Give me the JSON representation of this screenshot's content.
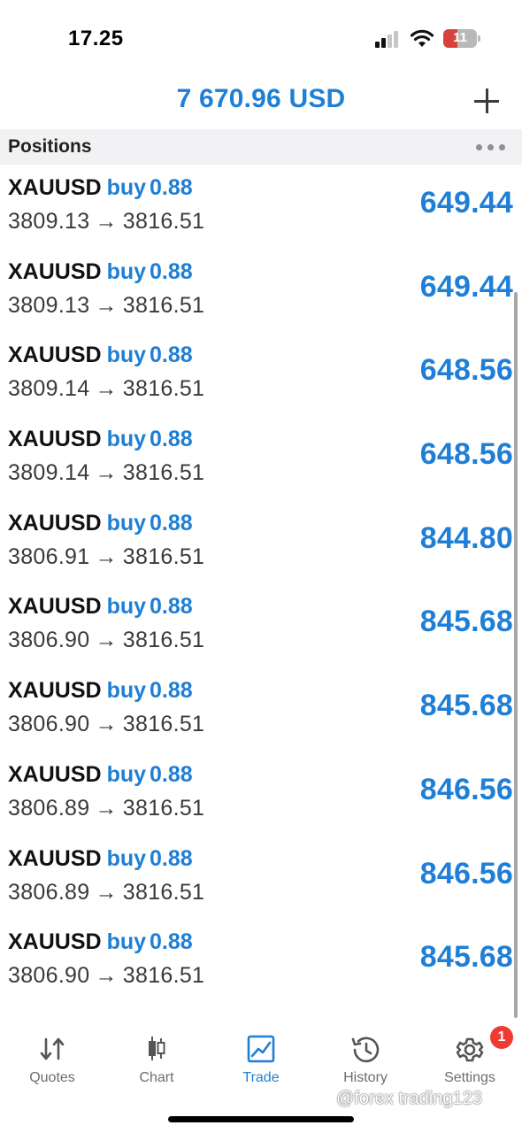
{
  "status_bar": {
    "time": "17.25",
    "battery": "11"
  },
  "header": {
    "balance": "7 670.96 USD"
  },
  "section": {
    "title": "Positions"
  },
  "positions": [
    {
      "symbol": "XAUUSD",
      "direction": "buy",
      "volume": "0.88",
      "open_price": "3809.13",
      "current_price": "3816.51",
      "profit": "649.44"
    },
    {
      "symbol": "XAUUSD",
      "direction": "buy",
      "volume": "0.88",
      "open_price": "3809.13",
      "current_price": "3816.51",
      "profit": "649.44"
    },
    {
      "symbol": "XAUUSD",
      "direction": "buy",
      "volume": "0.88",
      "open_price": "3809.14",
      "current_price": "3816.51",
      "profit": "648.56"
    },
    {
      "symbol": "XAUUSD",
      "direction": "buy",
      "volume": "0.88",
      "open_price": "3809.14",
      "current_price": "3816.51",
      "profit": "648.56"
    },
    {
      "symbol": "XAUUSD",
      "direction": "buy",
      "volume": "0.88",
      "open_price": "3806.91",
      "current_price": "3816.51",
      "profit": "844.80"
    },
    {
      "symbol": "XAUUSD",
      "direction": "buy",
      "volume": "0.88",
      "open_price": "3806.90",
      "current_price": "3816.51",
      "profit": "845.68"
    },
    {
      "symbol": "XAUUSD",
      "direction": "buy",
      "volume": "0.88",
      "open_price": "3806.90",
      "current_price": "3816.51",
      "profit": "845.68"
    },
    {
      "symbol": "XAUUSD",
      "direction": "buy",
      "volume": "0.88",
      "open_price": "3806.89",
      "current_price": "3816.51",
      "profit": "846.56"
    },
    {
      "symbol": "XAUUSD",
      "direction": "buy",
      "volume": "0.88",
      "open_price": "3806.89",
      "current_price": "3816.51",
      "profit": "846.56"
    },
    {
      "symbol": "XAUUSD",
      "direction": "buy",
      "volume": "0.88",
      "open_price": "3806.90",
      "current_price": "3816.51",
      "profit": "845.68"
    }
  ],
  "tabs": [
    {
      "label": "Quotes",
      "icon": "quotes-arrows-icon"
    },
    {
      "label": "Chart",
      "icon": "candlestick-icon"
    },
    {
      "label": "Trade",
      "icon": "trade-chart-icon",
      "active": true
    },
    {
      "label": "History",
      "icon": "history-clock-icon"
    },
    {
      "label": "Settings",
      "icon": "gear-icon",
      "badge": "1"
    }
  ],
  "watermark": "@forex trading123",
  "colors": {
    "accent": "#1f7fd6",
    "badge": "#ef3b30",
    "section_bg": "#f2f2f4"
  }
}
